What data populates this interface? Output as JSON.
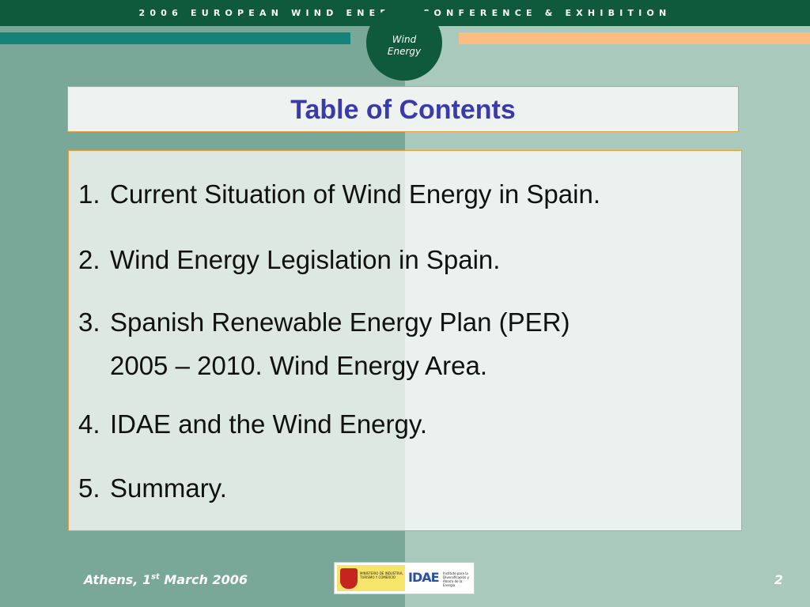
{
  "header": {
    "conference": "2006 EUROPEAN WIND ENERGY CONFERENCE & EXHIBITION",
    "badge_line1": "Wind",
    "badge_line2": "Energy"
  },
  "title": "Table of Contents",
  "toc": [
    {
      "num": "1.",
      "text": "Current Situation of Wind Energy in Spain."
    },
    {
      "num": "2.",
      "text": "Wind Energy Legislation in Spain."
    },
    {
      "num": "3.",
      "text": "Spanish Renewable Energy Plan (PER)",
      "text2": "2005 – 2010. Wind Energy Area."
    },
    {
      "num": "4.",
      "text": "IDAE and the Wind Energy."
    },
    {
      "num": "5.",
      "text": "Summary."
    }
  ],
  "footer": {
    "city": "Athens, 1",
    "ordinal": "st",
    "date": " March 2006",
    "page": "2",
    "logo_ministry": "MINISTERIO DE INDUSTRIA, TURISMO Y COMERCIO",
    "logo_idae_mark": "IDAE",
    "logo_idae_text": "Instituto para la Diversificación y Ahorro de la Energía"
  },
  "colors": {
    "header_green": "#0f5a3c",
    "teal_stripe": "#14837a",
    "orange_stripe": "#fbbd82",
    "title_blue": "#3a3aad",
    "box_border": "#e4a13c"
  }
}
